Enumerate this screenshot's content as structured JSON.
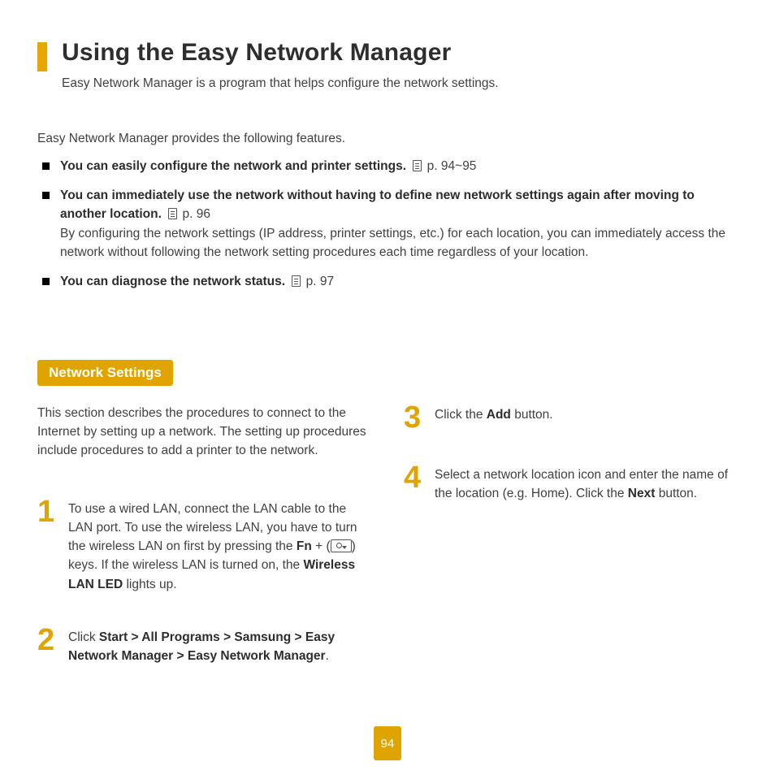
{
  "header": {
    "title": "Using the Easy Network Manager",
    "subtitle": "Easy Network Manager is a program that helps configure the network settings."
  },
  "intro": "Easy Network Manager provides the following features.",
  "features": [
    {
      "bold": "You can easily configure the network and printer settings.",
      "ref": " p. 94~95",
      "desc": ""
    },
    {
      "bold": "You can immediately use the network without having to define new network settings again after moving to another location.",
      "ref": " p. 96",
      "desc": "By configuring the network settings (IP address, printer settings, etc.) for each location, you can immediately access the network without following the network setting procedures each time regardless of your location."
    },
    {
      "bold": "You can diagnose the network status.",
      "ref": " p. 97",
      "desc": ""
    }
  ],
  "section": {
    "label": "Network Settings"
  },
  "section_intro": "This section describes the procedures to connect to the Internet by setting up a network. The setting up procedures include procedures to add a printer to the network.",
  "steps": {
    "s1": {
      "pre": "To use a wired LAN, connect the LAN cable to the LAN port. To use the wireless LAN, you have to turn the wireless LAN on first by pressing the  ",
      "fn": "Fn",
      "mid": " + (",
      "post": ") keys. If the wireless LAN is turned on, the ",
      "led": "Wireless LAN LED",
      "tail": " lights up."
    },
    "s2": {
      "pre": "Click ",
      "path": "Start > All Programs > Samsung > Easy Network Manager > Easy Network Manager",
      "post": "."
    },
    "s3": {
      "pre": "Click the ",
      "btn": "Add",
      "post": " button."
    },
    "s4": {
      "pre": "Select a network location icon and enter the name of the location (e.g. Home). Click the ",
      "btn": "Next",
      "post": " button."
    }
  },
  "page_number": "94"
}
